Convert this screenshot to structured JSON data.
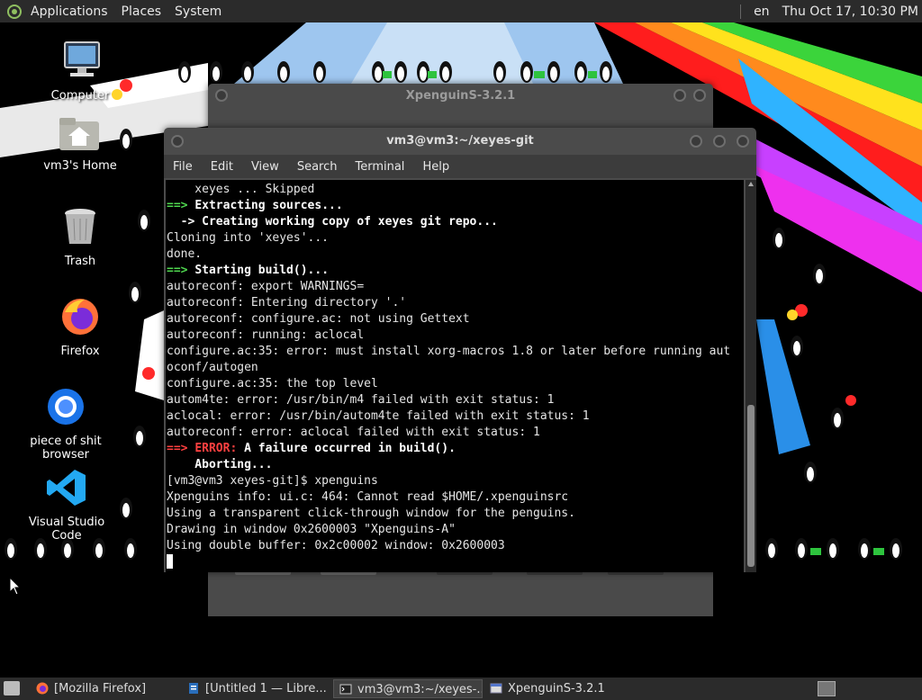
{
  "top_panel": {
    "menus": [
      "Applications",
      "Places",
      "System"
    ],
    "keyboard_layout": "en",
    "clock": "Thu Oct 17, 10:30 PM"
  },
  "desktop": {
    "icons": [
      {
        "label": "Computer",
        "icon": "computer-icon"
      },
      {
        "label": "vm3's Home",
        "icon": "home-folder-icon"
      },
      {
        "label": "Trash",
        "icon": "trash-icon"
      },
      {
        "label": "Firefox",
        "icon": "firefox-icon"
      },
      {
        "label": "piece of shit browser",
        "icon": "chromium-icon"
      },
      {
        "label": "Visual Studio Code",
        "icon": "vscode-icon"
      }
    ]
  },
  "xpenguins_window": {
    "title": "XpenguinS-3.2.1"
  },
  "terminal": {
    "title": "vm3@vm3:~/xeyes-git",
    "menus": [
      "File",
      "Edit",
      "View",
      "Search",
      "Terminal",
      "Help"
    ],
    "lines": [
      [
        {
          "t": "    xeyes ... Skipped",
          "c": ""
        }
      ],
      [
        {
          "t": "==> ",
          "c": "g"
        },
        {
          "t": "Extracting sources...",
          "c": "b"
        }
      ],
      [
        {
          "t": "  -> ",
          "c": "b"
        },
        {
          "t": "Creating working copy of xeyes git repo...",
          "c": "b"
        }
      ],
      [
        {
          "t": "Cloning into 'xeyes'...",
          "c": ""
        }
      ],
      [
        {
          "t": "done.",
          "c": ""
        }
      ],
      [
        {
          "t": "==> ",
          "c": "g"
        },
        {
          "t": "Starting build()...",
          "c": "b"
        }
      ],
      [
        {
          "t": "autoreconf: export WARNINGS=",
          "c": ""
        }
      ],
      [
        {
          "t": "autoreconf: Entering directory '.'",
          "c": ""
        }
      ],
      [
        {
          "t": "autoreconf: configure.ac: not using Gettext",
          "c": ""
        }
      ],
      [
        {
          "t": "autoreconf: running: aclocal",
          "c": ""
        }
      ],
      [
        {
          "t": "configure.ac:35: error: must install xorg-macros 1.8 or later before running aut",
          "c": ""
        }
      ],
      [
        {
          "t": "oconf/autogen",
          "c": ""
        }
      ],
      [
        {
          "t": "configure.ac:35: the top level",
          "c": ""
        }
      ],
      [
        {
          "t": "autom4te: error: /usr/bin/m4 failed with exit status: 1",
          "c": ""
        }
      ],
      [
        {
          "t": "aclocal: error: /usr/bin/autom4te failed with exit status: 1",
          "c": ""
        }
      ],
      [
        {
          "t": "autoreconf: error: aclocal failed with exit status: 1",
          "c": ""
        }
      ],
      [
        {
          "t": "==> ",
          "c": "r"
        },
        {
          "t": "ERROR: ",
          "c": "r"
        },
        {
          "t": "A failure occurred in build().",
          "c": "b"
        }
      ],
      [
        {
          "t": "    Aborting...",
          "c": "b"
        }
      ],
      [
        {
          "t": "[vm3@vm3 xeyes-git]$ xpenguins",
          "c": ""
        }
      ],
      [
        {
          "t": "Xpenguins info: ui.c: 464: Cannot read $HOME/.xpenguinsrc",
          "c": ""
        }
      ],
      [
        {
          "t": "Using a transparent click-through window for the penguins.",
          "c": ""
        }
      ],
      [
        {
          "t": "Drawing in window 0x2600003 \"Xpenguins-A\"",
          "c": ""
        }
      ],
      [
        {
          "t": "Using double buffer: 0x2c00002 window: 0x2600003",
          "c": ""
        }
      ]
    ]
  },
  "taskbar": {
    "tasks": [
      {
        "label": "[Mozilla Firefox]",
        "icon": "firefox-icon"
      },
      {
        "label": "[Untitled 1 — Libre...",
        "icon": "libreoffice-icon"
      },
      {
        "label": "vm3@vm3:~/xeyes-...",
        "icon": "terminal-icon"
      },
      {
        "label": "XpenguinS-3.2.1",
        "icon": "window-icon"
      }
    ]
  },
  "colors": {
    "panel": "#2b2b2b",
    "terminal_bg": "#000000",
    "green": "#4fd84f",
    "red": "#ff4040"
  }
}
